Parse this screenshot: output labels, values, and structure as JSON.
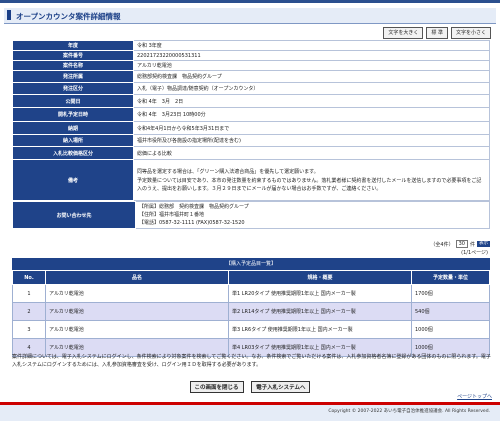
{
  "page_title": "オープンカウンタ案件詳細情報",
  "font_buttons": {
    "large": "文字を大きく",
    "standard": "標 準",
    "small": "文字を小さく"
  },
  "detail": {
    "rows": [
      {
        "label": "年度",
        "value": "令和 3年度"
      },
      {
        "label": "案件番号",
        "value": "22021723220000531311"
      },
      {
        "label": "案件名称",
        "value": "アルカリ乾電池"
      },
      {
        "label": "発注所属",
        "value": "総務部契約検査課　物品契約グループ"
      },
      {
        "label": "発注区分",
        "value": "入札（電子）物品調達/随意契約（オープンカウンタ）"
      },
      {
        "label": "公開日",
        "value": "令和 4年　3月　2日"
      },
      {
        "label": "開札予定日時",
        "value": "令和 4年　3月23日 10時00分"
      },
      {
        "label": "納期",
        "value": "令和4年4月1日から令和5年3月31日まで"
      },
      {
        "label": "納入場所",
        "value": "福井市役所及び各施設の指定場所(配達を含む)"
      },
      {
        "label": "入札比較価格区分",
        "value": "総価による比較"
      }
    ],
    "notes_label": "備考",
    "notes": [
      "同等品を選定する場合は、「グリーン購入法適合商品」を優先して選定願います。",
      "予定数量については目安であり、本市の発注数量を約束するものではありません。落札業者様に契約書を送付したメールを送信しますので必要事項をご記入のうえ、提出をお願いします。３月２９日までにメールが届かない場合はお手数ですが、ご連絡ください。"
    ]
  },
  "contact": {
    "label": "お問い合わせ先",
    "lines": [
      "【所属】総務部　契約検査課　物品契約グループ",
      "【住所】福井市福井町１番地",
      "【電話】0587-32-1111 (FAX)0587-32-1520"
    ]
  },
  "pager": {
    "prefix": "（全4件）",
    "per_page": "30",
    "per_page_suffix": "件",
    "button": "表示",
    "pages": "(1/1ページ)"
  },
  "items_title": "【購入予定品目一覧】",
  "items": {
    "headers": [
      "No.",
      "品名",
      "規格・概要",
      "予定数量・単位"
    ],
    "rows": [
      {
        "no": "1",
        "name": "アルカリ乾電池",
        "spec": "単1 LR20タイプ 使用推奨期限1年以上 国内メーカー製",
        "qty": "1700個"
      },
      {
        "no": "2",
        "name": "アルカリ乾電池",
        "spec": "単2 LR14タイプ 使用推奨期限1年以上 国内メーカー製",
        "qty": "540個"
      },
      {
        "no": "3",
        "name": "アルカリ乾電池",
        "spec": "単3 LR6タイプ 使用推奨期限1年以上 国内メーカー製",
        "qty": "1000個"
      },
      {
        "no": "4",
        "name": "アルカリ乾電池",
        "spec": "単4 LR03タイプ 使用推奨期限1年以上 国内メーカー製",
        "qty": "1000個"
      }
    ]
  },
  "footnote": "案件詳細については、電子入札システムにログインし、条件検索により対象案件を検索してご覧ください。なお、条件検索でご覧いただける案件は、入札参加資格者名簿に登録がある団体のものに限られます。電子入札システムにログインするためには、入札参加資格審査を受け、ログイン用ＩＤを取得する必要があります。",
  "buttons": {
    "close": "この画面を閉じる",
    "system": "電子入札システムへ"
  },
  "page_top": "ページトップへ",
  "footer": "Copyright © 2007-2022 あいち電子自治体推進協議会. All Rights Reserved."
}
